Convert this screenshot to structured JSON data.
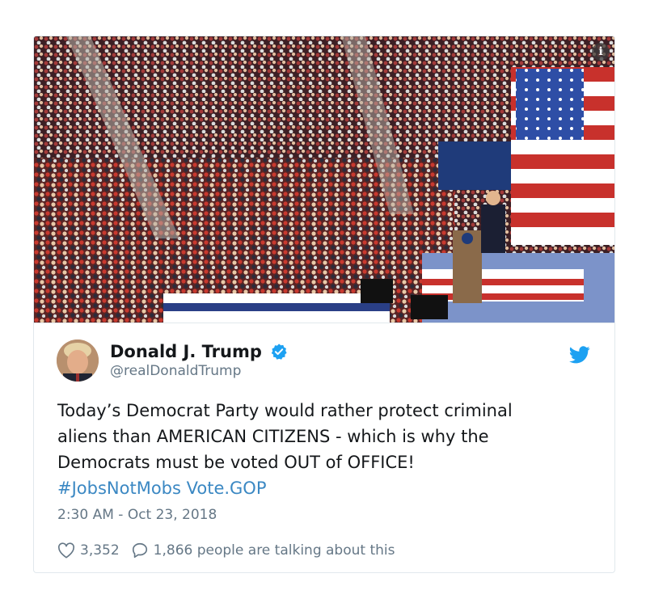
{
  "tweet": {
    "display_name": "Donald J. Trump",
    "handle": "@realDonaldTrump",
    "text_lines": [
      "Today’s Democrat Party would rather protect criminal",
      "aliens than AMERICAN CITIZENS - which is why the",
      "Democrats must be voted OUT of OFFICE!"
    ],
    "hashtag": "#JobsNotMobs",
    "link": "Vote.GOP",
    "timestamp": "2:30 AM - Oct 23, 2018",
    "likes": "3,352",
    "replies_text": "1,866 people are talking about this"
  },
  "media": {
    "info_symbol": "i",
    "icon": "rally-photo"
  },
  "icons": {
    "verified": "verified-badge-icon",
    "bird": "twitter-bird-icon",
    "heart": "heart-icon",
    "reply": "reply-bubble-icon"
  },
  "colors": {
    "verified_blue": "#1da1f2",
    "hashtag_blue": "#3b88c3",
    "muted_gray": "#657786"
  }
}
